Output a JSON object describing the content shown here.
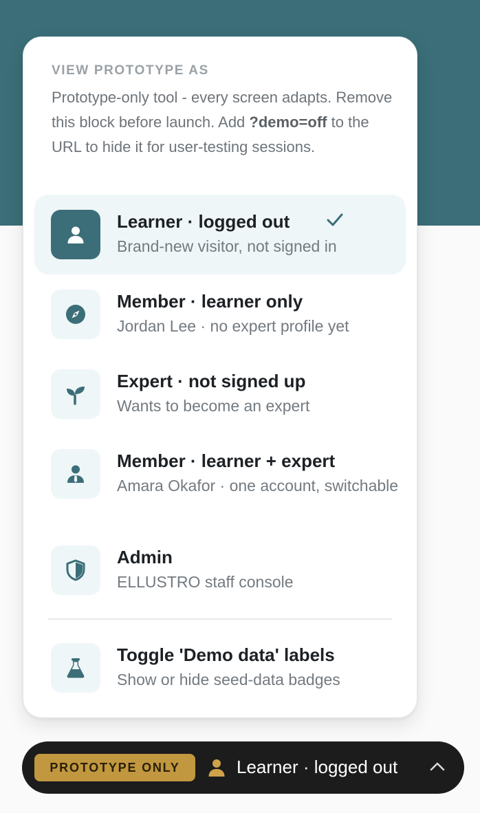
{
  "panel": {
    "eyebrow": "VIEW PROTOTYPE AS",
    "intro": {
      "text_before": "Prototype-only tool - every screen adapts. Remove this block before launch. Add ",
      "code": "?demo=off",
      "text_after": " to the URL to hide it for user-testing sessions."
    },
    "roles": [
      {
        "title": "Learner · logged out",
        "subtitle": "Brand-new visitor, not signed in",
        "icon": "person-icon",
        "selected": true
      },
      {
        "title": "Member · learner only",
        "subtitle": "Jordan Lee · no expert profile yet",
        "icon": "compass-icon",
        "selected": false
      },
      {
        "title": "Expert · not signed up",
        "subtitle": "Wants to become an expert",
        "icon": "sprout-icon",
        "selected": false
      },
      {
        "title": "Member · learner + expert",
        "subtitle": "Amara Okafor · one account, switchable",
        "icon": "person-tie-icon",
        "selected": false
      },
      {
        "title": "Admin",
        "subtitle": "ELLUSTRO staff console",
        "icon": "shield-icon",
        "selected": false
      }
    ],
    "toggle": {
      "title": "Toggle 'Demo data' labels",
      "subtitle": "Show or hide seed-data badges",
      "icon": "flask-icon"
    }
  },
  "bottom_bar": {
    "badge": "PROTOTYPE ONLY",
    "current_role": "Learner · logged out",
    "icon": "user-icon",
    "chevron": "chevron-up-icon"
  },
  "colors": {
    "header_teal": "#3b6e78",
    "selected_bg": "#eff6f8",
    "badge_gold": "#c1973f",
    "bar_bg": "#1c1c1c"
  }
}
